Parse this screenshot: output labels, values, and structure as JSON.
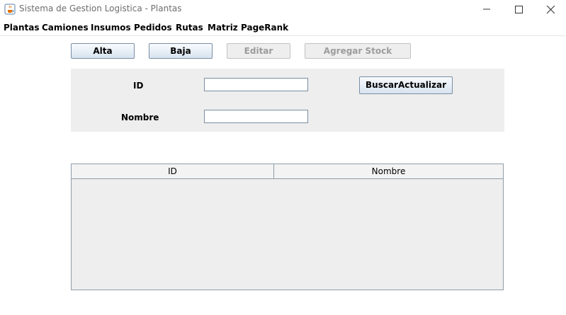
{
  "window": {
    "title": "Sistema de Gestion Logistica - Plantas",
    "icon": "java-cup-icon",
    "controls": [
      "minimize-icon",
      "maximize-icon",
      "close-icon"
    ]
  },
  "menu": {
    "items": [
      "Plantas",
      "Camiones",
      "Insumos",
      "Pedidos",
      "Rutas",
      "Matriz",
      "PageRank"
    ]
  },
  "toolbar": {
    "alta": "Alta",
    "baja": "Baja",
    "editar": "Editar",
    "agregar_stock": "Agregar Stock"
  },
  "form": {
    "id_label": "ID",
    "id_value": "",
    "nombre_label": "Nombre",
    "nombre_value": "",
    "buscar_button": "BuscarActualizar"
  },
  "table": {
    "columns": [
      "ID",
      "Nombre"
    ],
    "rows": []
  }
}
